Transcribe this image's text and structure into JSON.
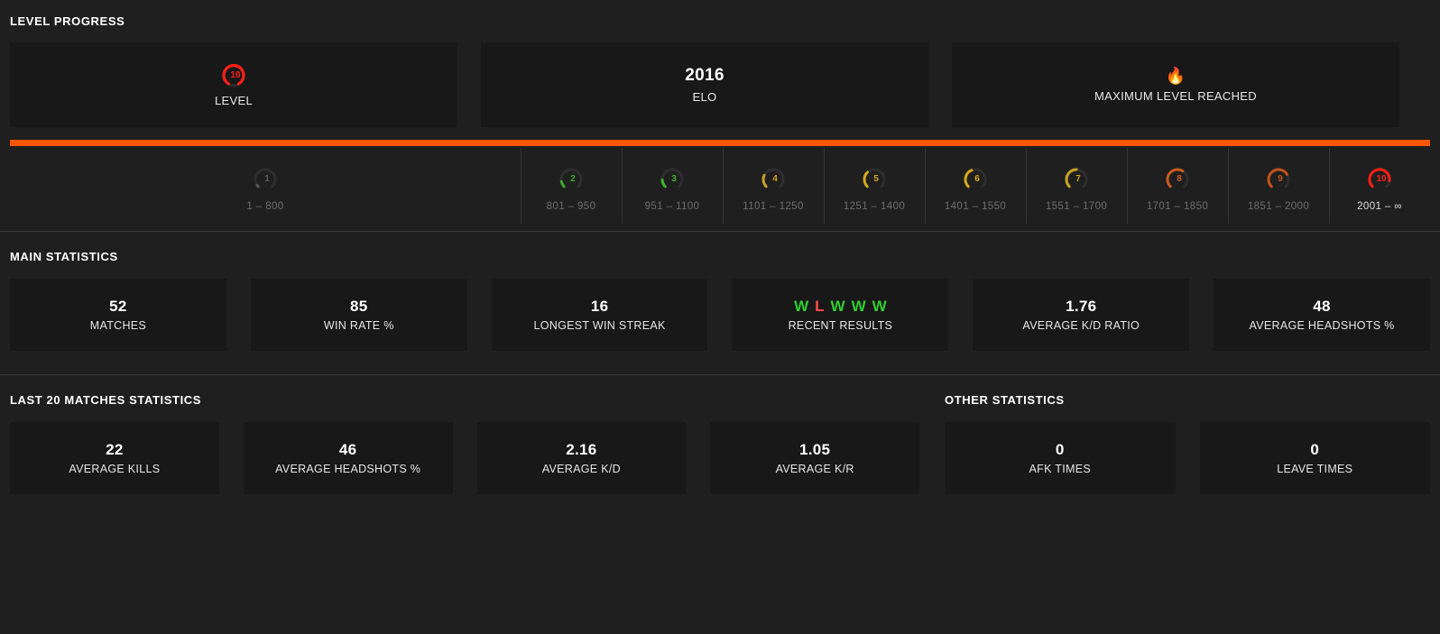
{
  "level_progress": {
    "title": "LEVEL PROGRESS",
    "cards": [
      {
        "name": "level",
        "icon": "level-10-gauge-icon",
        "value": "10",
        "label": "LEVEL"
      },
      {
        "name": "elo",
        "value": "2016",
        "label": "ELO"
      },
      {
        "name": "max-level",
        "icon": "fire-icon",
        "icon_glyph": "🔥",
        "label": "MAXIMUM LEVEL REACHED"
      }
    ],
    "progress_percent": 100,
    "progress_color": "#ff5500",
    "scale": [
      {
        "level": "1",
        "range": "1 – 800",
        "color": "#5c5c5c",
        "arc": 3,
        "active": false
      },
      {
        "level": "2",
        "range": "801 – 950",
        "color": "#3ba82b",
        "arc": 12,
        "active": false
      },
      {
        "level": "3",
        "range": "951 – 1100",
        "color": "#3eb62c",
        "arc": 16,
        "active": false
      },
      {
        "level": "4",
        "range": "1101 – 1250",
        "color": "#c9a227",
        "arc": 26,
        "active": false
      },
      {
        "level": "5",
        "range": "1251 – 1400",
        "color": "#d4a820",
        "arc": 34,
        "active": false
      },
      {
        "level": "6",
        "range": "1401 – 1550",
        "color": "#d9a81c",
        "arc": 42,
        "active": false
      },
      {
        "level": "7",
        "range": "1551 – 1700",
        "color": "#c8a520",
        "arc": 50,
        "active": false
      },
      {
        "level": "8",
        "range": "1701 – 1850",
        "color": "#c85a1e",
        "arc": 62,
        "active": false
      },
      {
        "level": "9",
        "range": "1851 – 2000",
        "color": "#c2511b",
        "arc": 72,
        "active": false
      },
      {
        "level": "10",
        "range": "2001 – ∞",
        "color": "#ff1f15",
        "arc": 86,
        "active": true
      }
    ]
  },
  "main_statistics": {
    "title": "MAIN STATISTICS",
    "cards": [
      {
        "value": "52",
        "label": "MATCHES"
      },
      {
        "value": "85",
        "label": "WIN RATE %"
      },
      {
        "value": "16",
        "label": "LONGEST WIN STREAK"
      },
      {
        "value": "",
        "label": "RECENT RESULTS",
        "results": [
          "W",
          "L",
          "W",
          "W",
          "W"
        ]
      },
      {
        "value": "1.76",
        "label": "AVERAGE K/D RATIO"
      },
      {
        "value": "48",
        "label": "AVERAGE HEADSHOTS %"
      }
    ]
  },
  "last_20_matches": {
    "title": "LAST 20 MATCHES STATISTICS",
    "cards": [
      {
        "value": "22",
        "label": "AVERAGE KILLS"
      },
      {
        "value": "46",
        "label": "AVERAGE HEADSHOTS %"
      },
      {
        "value": "2.16",
        "label": "AVERAGE K/D"
      },
      {
        "value": "1.05",
        "label": "AVERAGE K/R"
      }
    ]
  },
  "other_statistics": {
    "title": "OTHER STATISTICS",
    "cards": [
      {
        "value": "0",
        "label": "AFK TIMES"
      },
      {
        "value": "0",
        "label": "LEAVE TIMES"
      }
    ]
  }
}
